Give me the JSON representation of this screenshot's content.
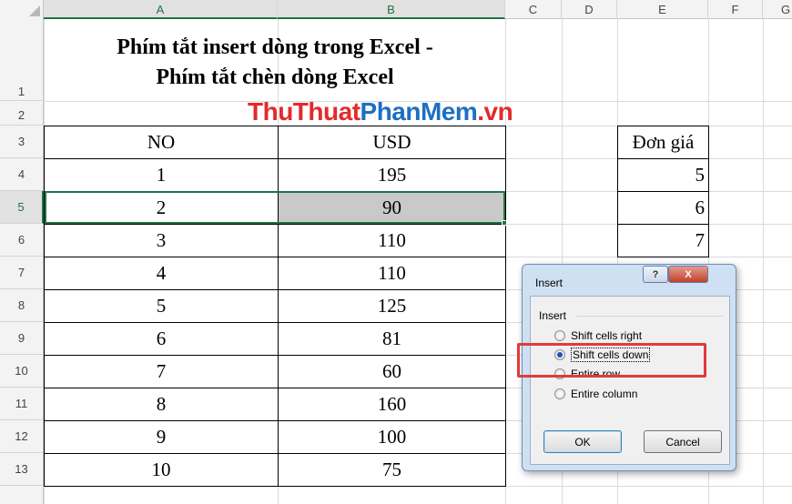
{
  "columns": [
    "A",
    "B",
    "C",
    "D",
    "E",
    "F",
    "G"
  ],
  "rows": [
    "1",
    "2",
    "3",
    "4",
    "5",
    "6",
    "7",
    "8",
    "9",
    "10",
    "11",
    "12",
    "13"
  ],
  "title": {
    "line1": "Phím tắt insert dòng trong Excel -",
    "line2": "Phím tắt chèn dòng Excel"
  },
  "watermark": {
    "part1": "ThuThuat",
    "part2": "PhanMem",
    "part3": ".vn"
  },
  "table": {
    "header": {
      "no": "NO",
      "usd": "USD"
    },
    "rows": [
      {
        "no": "1",
        "usd": "195"
      },
      {
        "no": "2",
        "usd": "90"
      },
      {
        "no": "3",
        "usd": "110"
      },
      {
        "no": "4",
        "usd": "110"
      },
      {
        "no": "5",
        "usd": "125"
      },
      {
        "no": "6",
        "usd": "81"
      },
      {
        "no": "7",
        "usd": "60"
      },
      {
        "no": "8",
        "usd": "160"
      },
      {
        "no": "9",
        "usd": "100"
      },
      {
        "no": "10",
        "usd": "75"
      }
    ]
  },
  "price_table": {
    "header": "Đơn giá",
    "values": [
      "5",
      "6",
      "7"
    ]
  },
  "dialog": {
    "title": "Insert",
    "group_label": "Insert",
    "options": [
      {
        "label": "Shift cells right",
        "selected": false
      },
      {
        "label": "Shift cells down",
        "selected": true
      },
      {
        "label": "Entire row",
        "selected": false
      },
      {
        "label": "Entire column",
        "selected": false
      }
    ],
    "ok_label": "OK",
    "cancel_label": "Cancel",
    "help_glyph": "?",
    "close_glyph": "X"
  },
  "colors": {
    "selection_green": "#217346",
    "highlight_red": "#e03b3b",
    "watermark_red": "#e32b2b",
    "watermark_blue": "#1e6fc2"
  }
}
